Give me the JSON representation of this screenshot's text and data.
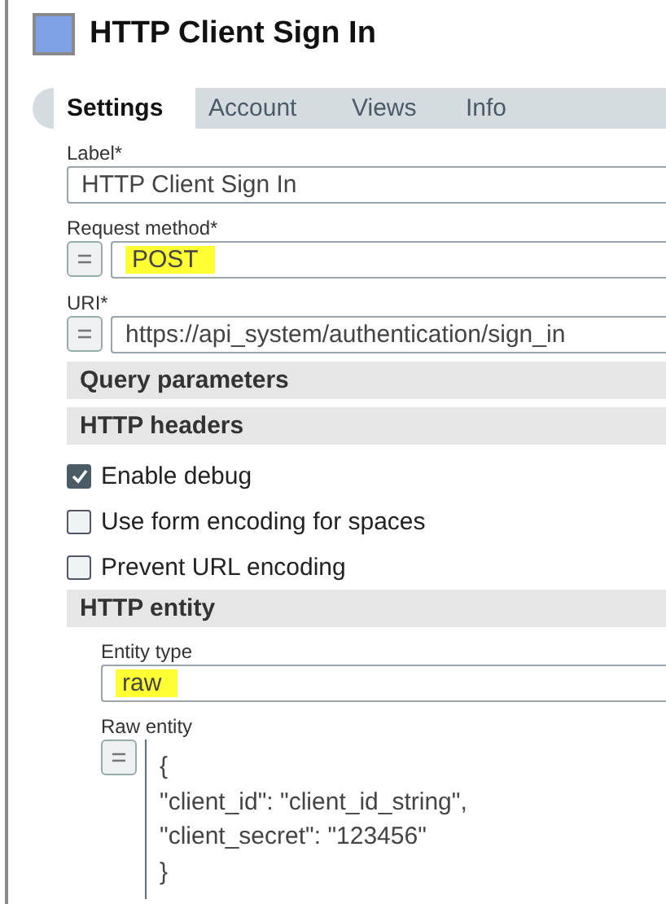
{
  "title": "HTTP Client Sign In",
  "tabs": [
    {
      "label": "Settings",
      "selected": true
    },
    {
      "label": "Account",
      "selected": false
    },
    {
      "label": "Views",
      "selected": false
    },
    {
      "label": "Info",
      "selected": false
    }
  ],
  "fields": [
    {
      "kind": "text",
      "label": "Label*",
      "value": "HTTP Client Sign In",
      "highlighted": false
    },
    {
      "kind": "expression",
      "label": "Request method*",
      "value": "POST",
      "highlighted": true
    },
    {
      "kind": "expression",
      "label": "URI*",
      "value": "https://api_system/authentication/sign_in",
      "highlighted": false
    }
  ],
  "sections": [
    {
      "title": "Query parameters"
    },
    {
      "title": "HTTP headers",
      "options": [
        {
          "label": "Enable debug",
          "checked": true
        },
        {
          "label": "Use form encoding for spaces",
          "checked": false
        },
        {
          "label": "Prevent URL encoding",
          "checked": false
        }
      ]
    },
    {
      "title": "HTTP entity",
      "fields": [
        {
          "kind": "text",
          "label": "Entity type",
          "value": "raw",
          "highlighted": true
        },
        {
          "kind": "code",
          "label": "Raw entity",
          "lines": [
            "{",
            "\"client_id\": \"client_id_string\",",
            "\"client_secret\": \"123456\"",
            "}"
          ]
        }
      ]
    }
  ]
}
